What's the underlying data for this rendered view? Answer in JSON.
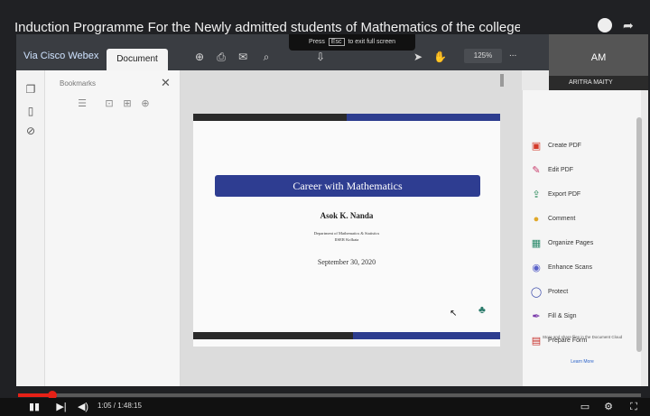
{
  "video": {
    "title": "Induction Programme For the Newly admitted students of Mathematics of the college",
    "progress_fraction": 0.055,
    "timecode": "1:05 / 1:48:15",
    "controls": {
      "play": "▮▮",
      "next": "▶|",
      "volume": "◀)",
      "cc": "▭",
      "settings": "⚙",
      "fullscreen": "⛶"
    }
  },
  "app": {
    "webex_label": "Via Cisco Webex",
    "document_tab": "Document",
    "fullscreen_tip": {
      "prefix": "Press",
      "key": "Esc",
      "suffix": "to exit full screen"
    },
    "zoom": "125%",
    "more": "...",
    "participant": {
      "initials": "AM",
      "name": "ARITRA MAITY"
    }
  },
  "bookmarks": {
    "title": "Bookmarks",
    "close": "✕"
  },
  "slide": {
    "title": "Career with Mathematics",
    "author": "Asok K. Nanda",
    "department": "Department of Mathematics & Statistics",
    "institute": "IISER Kolkata",
    "date": "September 30, 2020"
  },
  "tools": {
    "items": [
      {
        "label": "Create PDF",
        "icon": "▣",
        "color": "#d43a2a"
      },
      {
        "label": "Edit PDF",
        "icon": "✎",
        "color": "#c83a6a"
      },
      {
        "label": "Export PDF",
        "icon": "⇪",
        "color": "#2a8a5a"
      },
      {
        "label": "Comment",
        "icon": "●",
        "color": "#e0a82a"
      },
      {
        "label": "Organize Pages",
        "icon": "▦",
        "color": "#2a8a6a"
      },
      {
        "label": "Enhance Scans",
        "icon": "◉",
        "color": "#5a62c9"
      },
      {
        "label": "Protect",
        "icon": "◯",
        "color": "#3a4aaa"
      },
      {
        "label": "Fill & Sign",
        "icon": "✒",
        "color": "#7a3aaa"
      },
      {
        "label": "Prepare Form",
        "icon": "▤",
        "color": "#c8302a"
      }
    ],
    "note": "Store and share files in the Document Cloud",
    "learn_more": "Learn More"
  }
}
